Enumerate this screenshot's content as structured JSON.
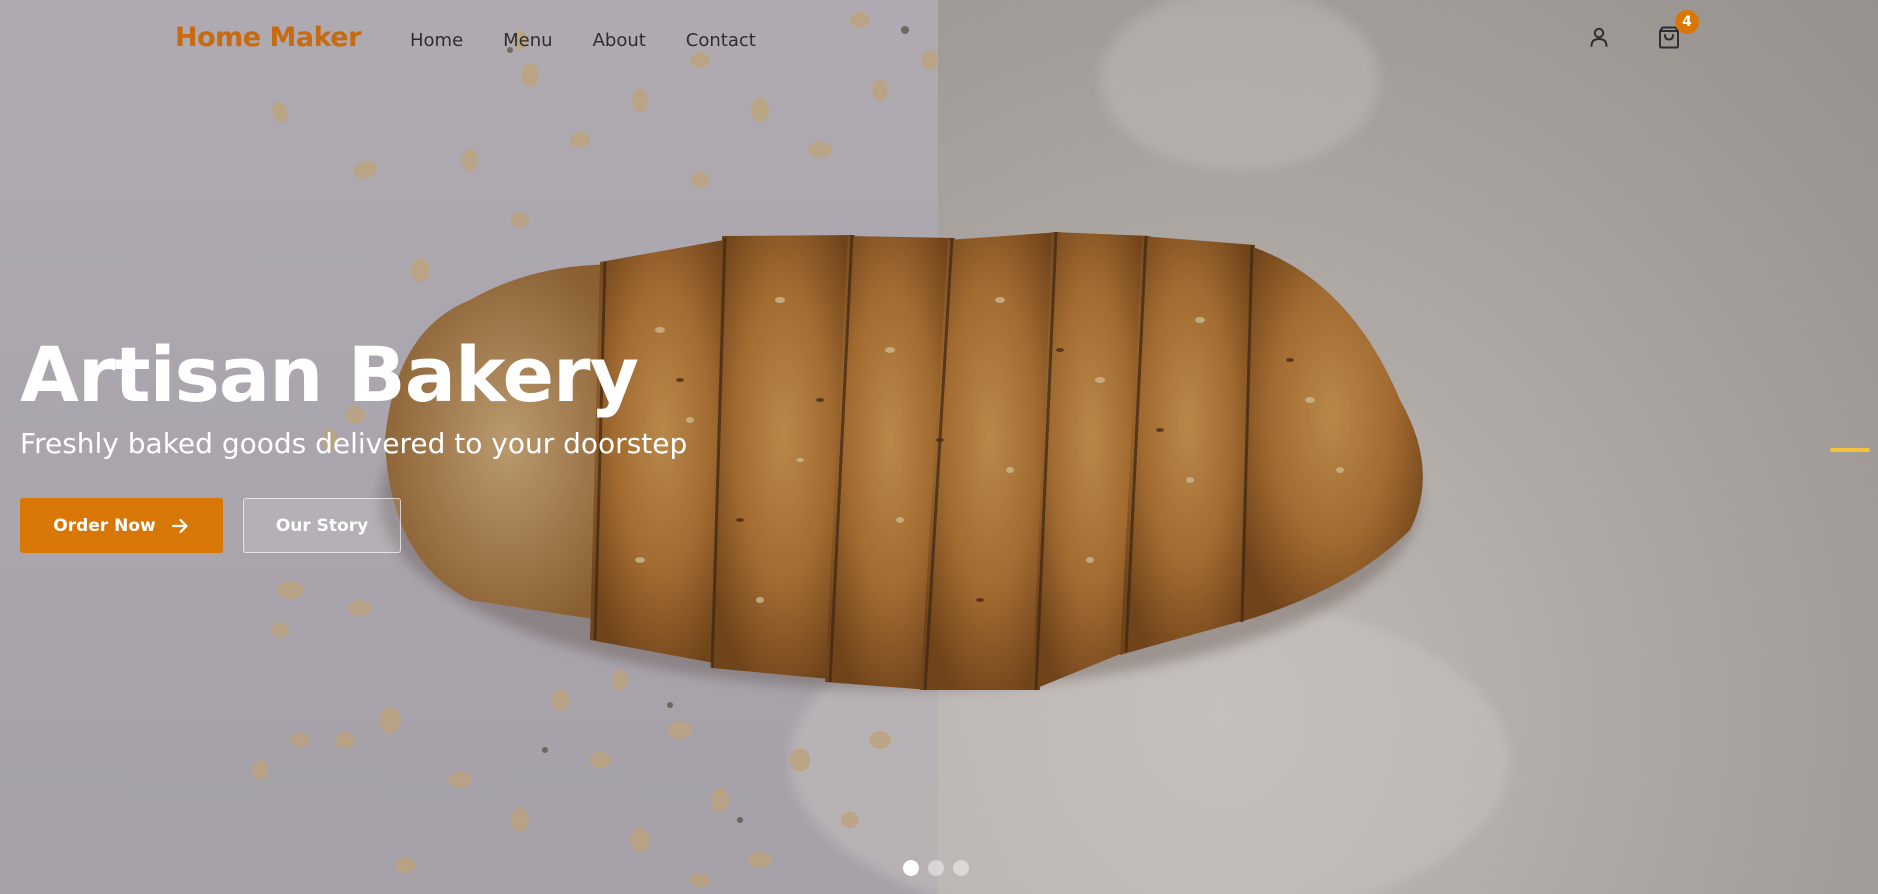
{
  "brand": {
    "name": "Home Maker",
    "color": "#c76a10"
  },
  "nav": {
    "links": [
      {
        "label": "Home"
      },
      {
        "label": "Menu"
      },
      {
        "label": "About"
      },
      {
        "label": "Contact"
      }
    ],
    "icons": {
      "account": "user-icon",
      "cart": "shopping-bag-icon"
    },
    "cart_count": "4"
  },
  "hero": {
    "title": "Artisan Bakery",
    "subtitle": "Freshly baked goods delivered to your doorstep",
    "primary_cta": {
      "label": "Order Now",
      "icon": "arrow-right-icon"
    },
    "secondary_cta": {
      "label": "Our Story"
    },
    "background_image": "sliced seeded bread loaf with oats on flour surface"
  },
  "carousel": {
    "slides_total": 3,
    "active_index": 0,
    "indicator_color": "#f2c23c"
  },
  "colors": {
    "accent": "#d97706",
    "nav_text": "#2d2d33",
    "hero_text": "#ffffff"
  }
}
